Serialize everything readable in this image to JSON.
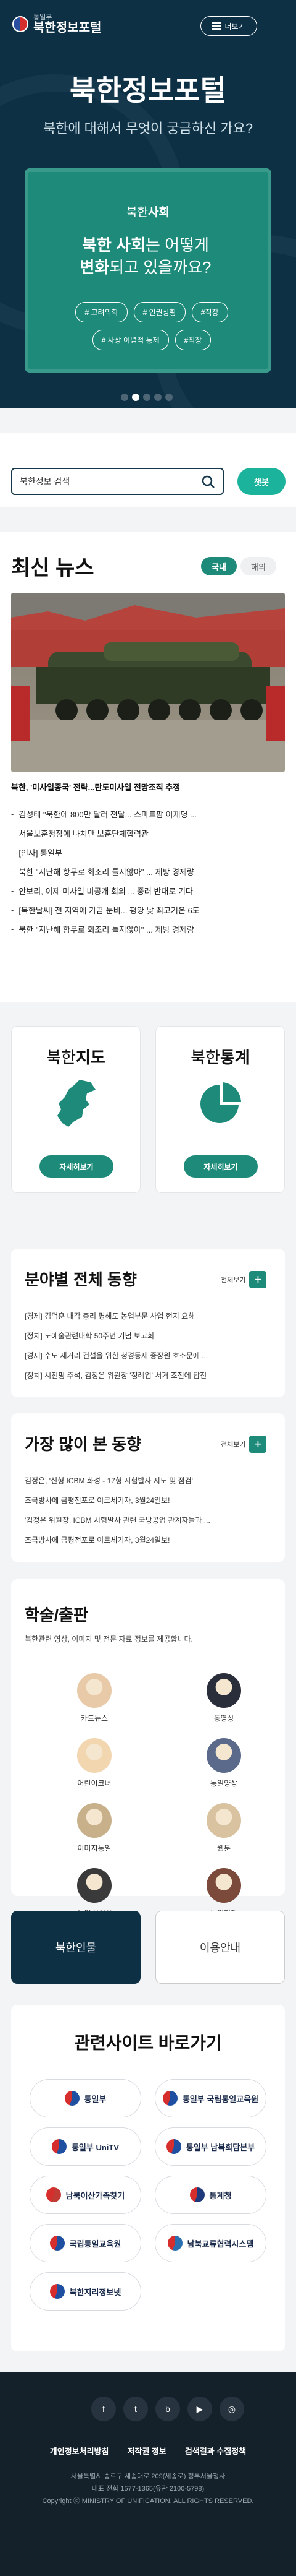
{
  "header": {
    "logo_sub": "통일부",
    "logo_main": "북한정보포털",
    "menu_label": "더보기"
  },
  "hero": {
    "title": "북한정보포털",
    "subtitle": "북한에 대해서 무엇이 궁금하신 가요?",
    "card": {
      "kicker_prefix": "북한",
      "kicker_bold": "사회",
      "q_bold1": "북한 사회",
      "q_text1": "는 어떻게",
      "q_bold2": "변화",
      "q_text2": "되고 있을까요?",
      "tags": [
        "# 고려의학",
        "# 인권상황",
        "#직장",
        "# 사상 이념적 통제",
        "#직장"
      ]
    },
    "slide_dots": 5,
    "active_dot": 1
  },
  "search": {
    "placeholder": "북한정보 검색",
    "chatbot_label": "챗봇"
  },
  "news": {
    "title": "최신 뉴스",
    "tabs": [
      "국내",
      "해외"
    ],
    "headline": "북한, '미사일종국' 전략...탄도미사일 전망조직 추정",
    "items": [
      "김성태 \"북한에 800만 달러 전달... 스마트팜 이재명 ...",
      "서울보훈청장에 나치만 보훈단체합력관",
      "[인사] 통일부",
      "북한 \"지난해 항무로 회조리 틀지않아\" ... 제방 경제량",
      "안보리, 이제 미사일 비공개 회의 ... 중러 반대로 기다",
      "[북한날씨] 전 지역에 가끔 눈비... 평양 낮 최고기온 6도",
      "북한 \"지난해 항무로 회조리 틀지않아\" ... 제방 경제량"
    ]
  },
  "quick": {
    "map_prefix": "북한",
    "map_bold": "지도",
    "stats_prefix": "북한",
    "stats_bold": "통계",
    "btn_label": "자세히보기"
  },
  "trend": {
    "title": "분야별 전체 동향",
    "more": "전체보기",
    "items": [
      "[경제] 김덕훈 내각 총리 평해도 농업부문 사업 현지 요해",
      "[정치] 도예술관련대학 50주년 기념 보고회",
      "[경제] 수도 세거리 건설을 위한 청경동제 증장원 호소문에 ...",
      "[정치] 시진핑 주석, 김정은 위원장 '정례업' 서거 조전에 답전"
    ]
  },
  "popular": {
    "title": "가장 많이 본 동향",
    "more": "전체보기",
    "items": [
      "김정은, '신형 ICBM 화성 - 17형 시험발사 지도 및 점검'",
      "조국방사에 금평전포로 이르세기자, 3월24일보!",
      "'김정은 위원장, ICBM 시험발사 관련 국방공업 관계자들과 ...",
      "조국방사에 금평전포로 이르세기자, 3월24일보!"
    ]
  },
  "pubs": {
    "title": "학술/출판",
    "desc": "북한관련 영상, 이미지 및 전문 자료 정보를 제공합니다.",
    "items": [
      "카드뉴스",
      "동영상",
      "어린이코너",
      "통일양상",
      "이미지통일",
      "웹툰",
      "통일 NOW",
      "통일현장"
    ]
  },
  "tabs_bottom": {
    "people": "북한인물",
    "guide": "이용안내"
  },
  "sites": {
    "title": "관련사이트 바로가기",
    "items": [
      "통일부",
      "통일부 국립통일교육원",
      "통일부 UniTV",
      "통일부 남북회담본부",
      "남북이산가족찾기",
      "통계청",
      "국립통일교육원",
      "남북교류협력시스템",
      "북한지리정보넷"
    ]
  },
  "footer": {
    "sns": [
      "f",
      "t",
      "b",
      "▶",
      "◎"
    ],
    "links": [
      "개인정보처리방침",
      "저작권 정보",
      "검색결과 수집정책"
    ],
    "address": "서울특별시 종로구 세종대로 209(세종로) 정부서울청사",
    "phone": "대표 전화 1577-1365(유관 2100-5798)",
    "copyright": "Copyright ⓒ MINISTRY OF UNIFICATION. ALL RIGHTS RESERVED."
  },
  "colors": {
    "navy": "#0d3045",
    "green": "#1e8b7a",
    "mint": "#1bb39c",
    "footer": "#14202a"
  }
}
